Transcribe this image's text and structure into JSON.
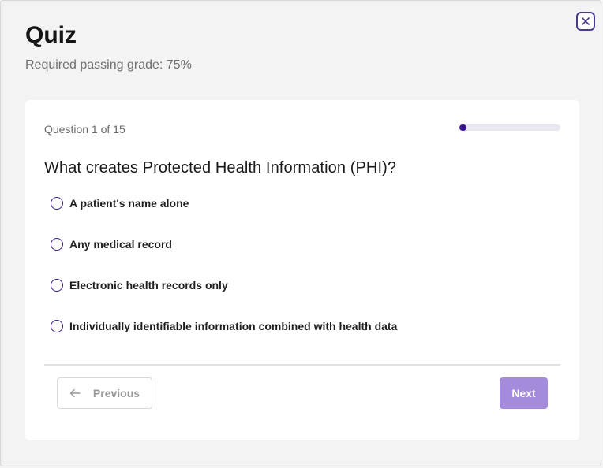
{
  "header": {
    "title": "Quiz",
    "subtitle": "Required passing grade: 75%"
  },
  "quiz": {
    "counter": "Question 1 of 15",
    "progress_percent": 6.67,
    "question": "What creates Protected Health Information (PHI)?",
    "options": [
      "A patient's name alone",
      "Any medical record",
      "Electronic health records only",
      "Individually identifiable information combined with health data"
    ]
  },
  "navigation": {
    "previous_label": "Previous",
    "next_label": "Next"
  },
  "icons": {
    "close": "close-icon",
    "previous": "arrow-left-icon"
  },
  "colors": {
    "accent": "#3d148f",
    "next_button": "#a58bdb",
    "progress_track": "#e9e7ef"
  }
}
